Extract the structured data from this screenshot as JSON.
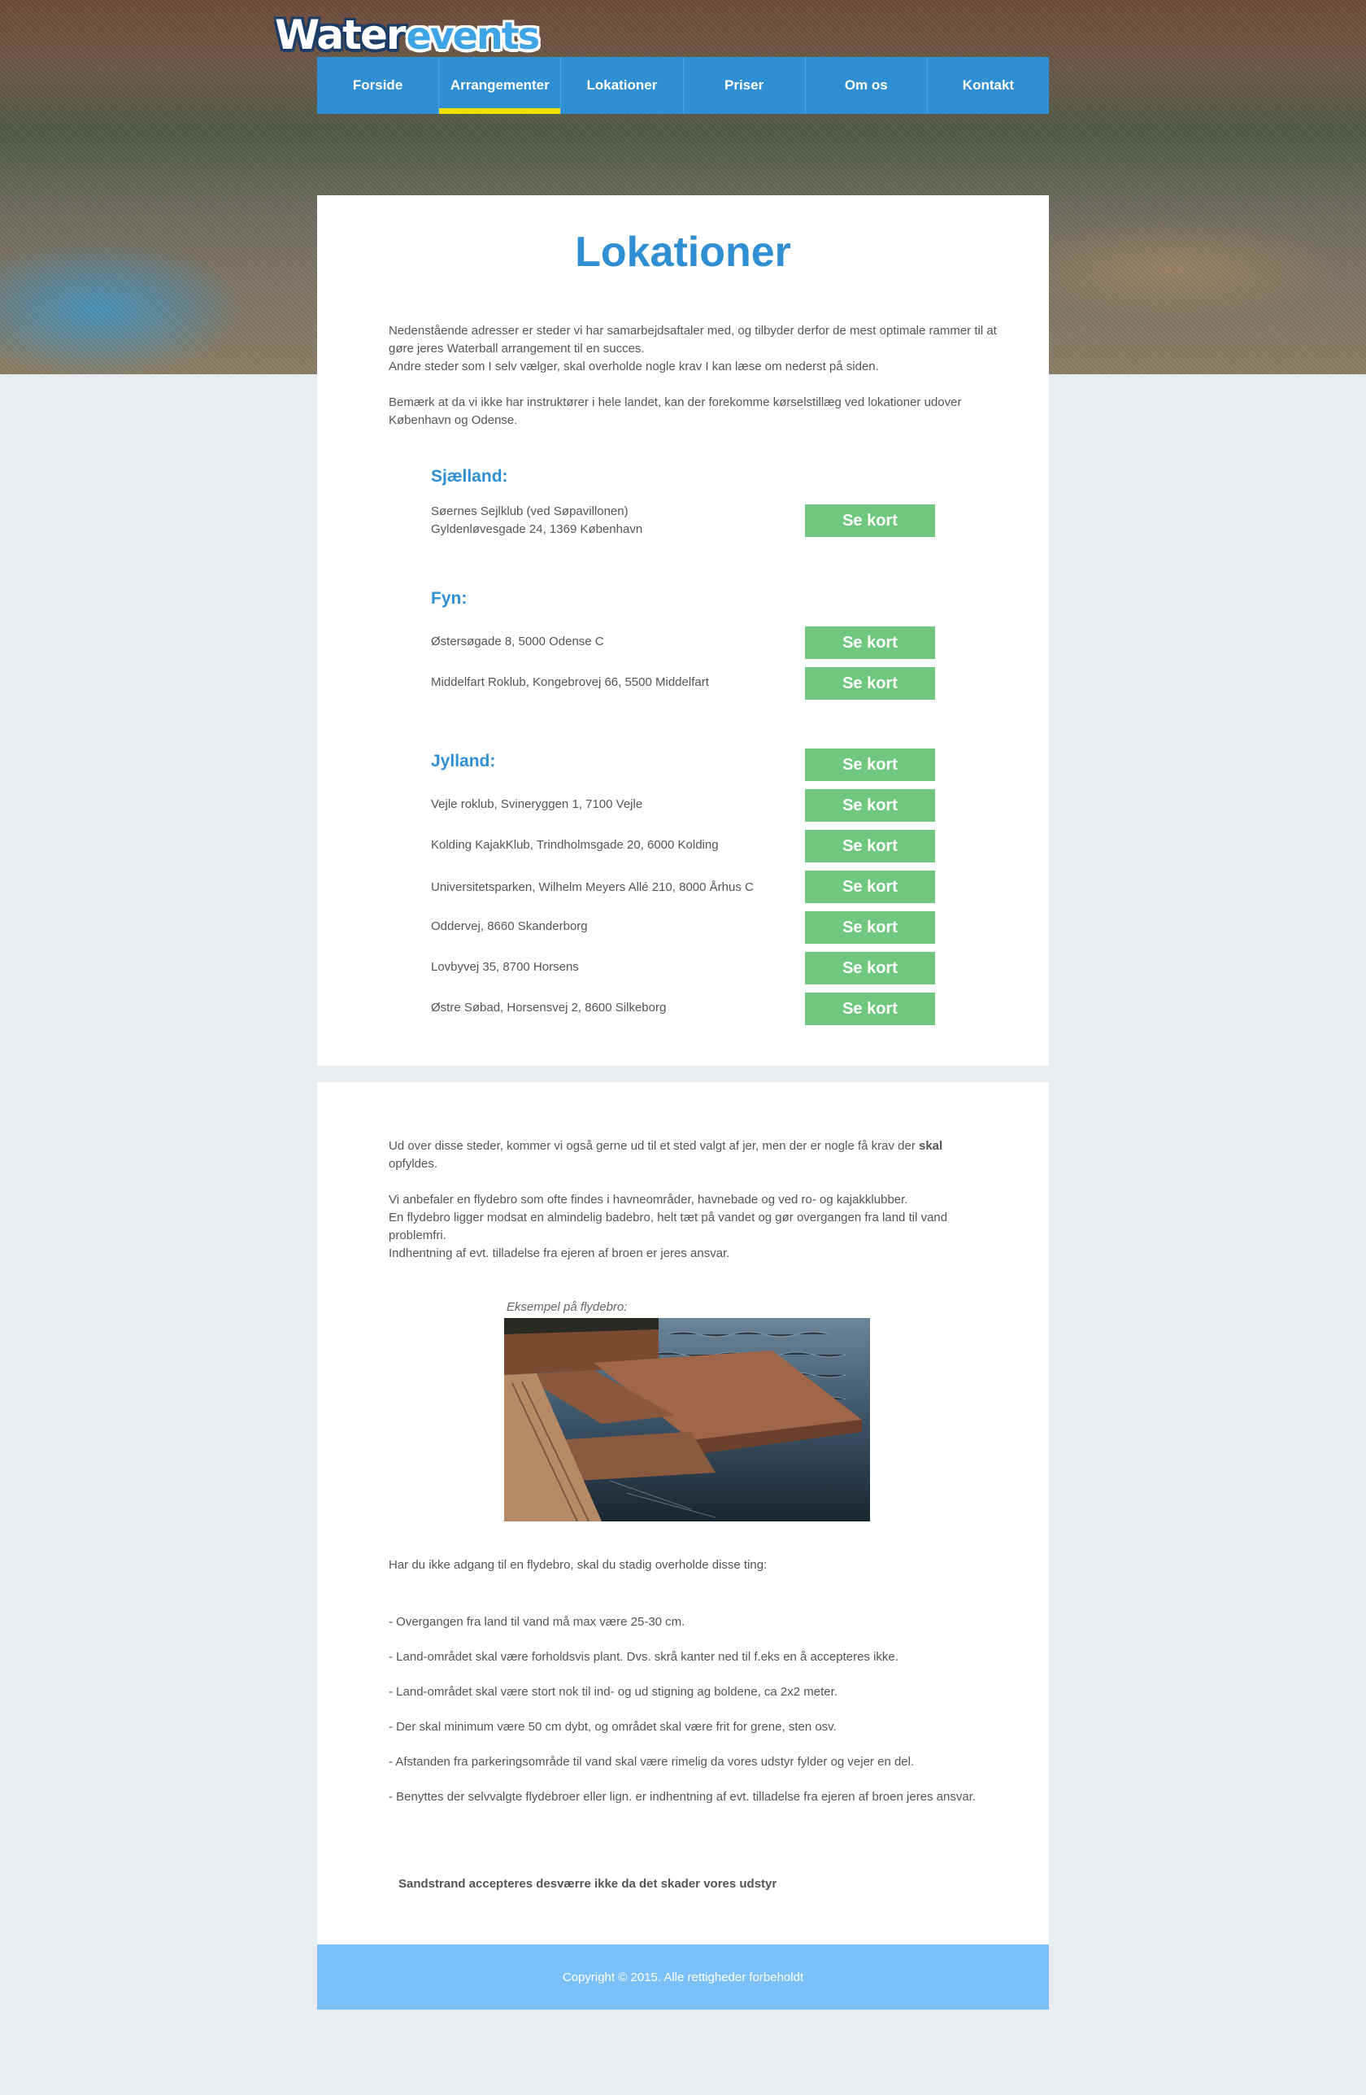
{
  "brand": {
    "logo_part1": "Water",
    "logo_part2": "events"
  },
  "nav": {
    "items": [
      {
        "label": "Forside"
      },
      {
        "label": "Arrangementer"
      },
      {
        "label": "Lokationer"
      },
      {
        "label": "Priser"
      },
      {
        "label": "Om os"
      },
      {
        "label": "Kontakt"
      }
    ],
    "active_index": 1
  },
  "main": {
    "title": "Lokationer",
    "intro_p1": "Nedenstående adresser er steder vi har samarbejdsaftaler med, og tilbyder derfor de mest optimale rammer til at gøre jeres Waterball arrangement til en succes.",
    "intro_p2": "Andre steder som I selv vælger, skal overholde nogle krav I kan læse om nederst på siden.",
    "intro_p3": "Bemærk at da vi ikke har instruktører i hele landet, kan der forekomme kørselstillæg ved lokationer udover København og Odense.",
    "button_label": "Se kort",
    "regions": [
      {
        "name": "Sjælland:",
        "locations": [
          {
            "line1": "Søernes Sejlklub (ved Søpavillonen)",
            "line2": "Gyldenløvesgade 24, 1369 København"
          }
        ]
      },
      {
        "name": "Fyn:",
        "locations": [
          {
            "line1": "Østersøgade 8, 5000 Odense C"
          },
          {
            "line1": "Middelfart Roklub, Kongebrovej 66, 5500 Middelfart"
          }
        ]
      },
      {
        "name": "Jylland:",
        "locations": [
          {
            "line1": "Vejle roklub, Svineryggen 1, 7100 Vejle"
          },
          {
            "line1": "Kolding KajakKlub, Trindholmsgade 20, 6000 Kolding"
          },
          {
            "line1": "Universitetsparken, Wilhelm Meyers Allé 210, 8000 Århus C"
          },
          {
            "line1": "Oddervej, 8660 Skanderborg"
          },
          {
            "line1": "Lovbyvej 35, 8700 Horsens"
          },
          {
            "line1": "Østre Søbad, Horsensvej 2, 8600 Silkeborg"
          }
        ]
      }
    ]
  },
  "requirements": {
    "p1_before": "Ud over disse steder, kommer vi også gerne ud til et sted valgt af jer, men der er nogle få krav der",
    "p1_bold": "skal",
    "p1_after": "opfyldes.",
    "p2": "Vi anbefaler en flydebro som ofte findes i havneområder, havnebade og ved ro- og kajakklubber.",
    "p3": "En flydebro ligger modsat en almindelig badebro, helt tæt på vandet og gør overgangen fra land til vand problemfri.",
    "p4": "Indhentning af evt. tilladelse fra ejeren af broen er jeres ansvar.",
    "caption": "Eksempel på flydebro:",
    "p5": "Har du ikke adgang til en flydebro, skal du stadig overholde disse ting:",
    "rules": [
      "- Overgangen fra land til vand må max være 25-30 cm.",
      "- Land-området skal være forholdsvis plant. Dvs. skrå kanter ned til f.eks en å accepteres ikke.",
      "- Land-området skal være stort nok til ind- og ud stigning ag boldene, ca 2x2 meter.",
      "- Der skal minimum være 50 cm dybt, og området skal være frit for grene, sten osv.",
      "- Afstanden fra parkeringsområde til vand skal være rimelig da vores udstyr fylder og vejer en del.",
      "- Benyttes der selvvalgte flydebroer eller lign. er indhentning af evt. tilladelse fra ejeren af broen jeres ansvar."
    ],
    "final_note": "Sandstrand accepteres desværre ikke da det skader vores udstyr"
  },
  "footer": {
    "copyright": "Copyright © 2015. Alle rettigheder forbeholdt"
  }
}
